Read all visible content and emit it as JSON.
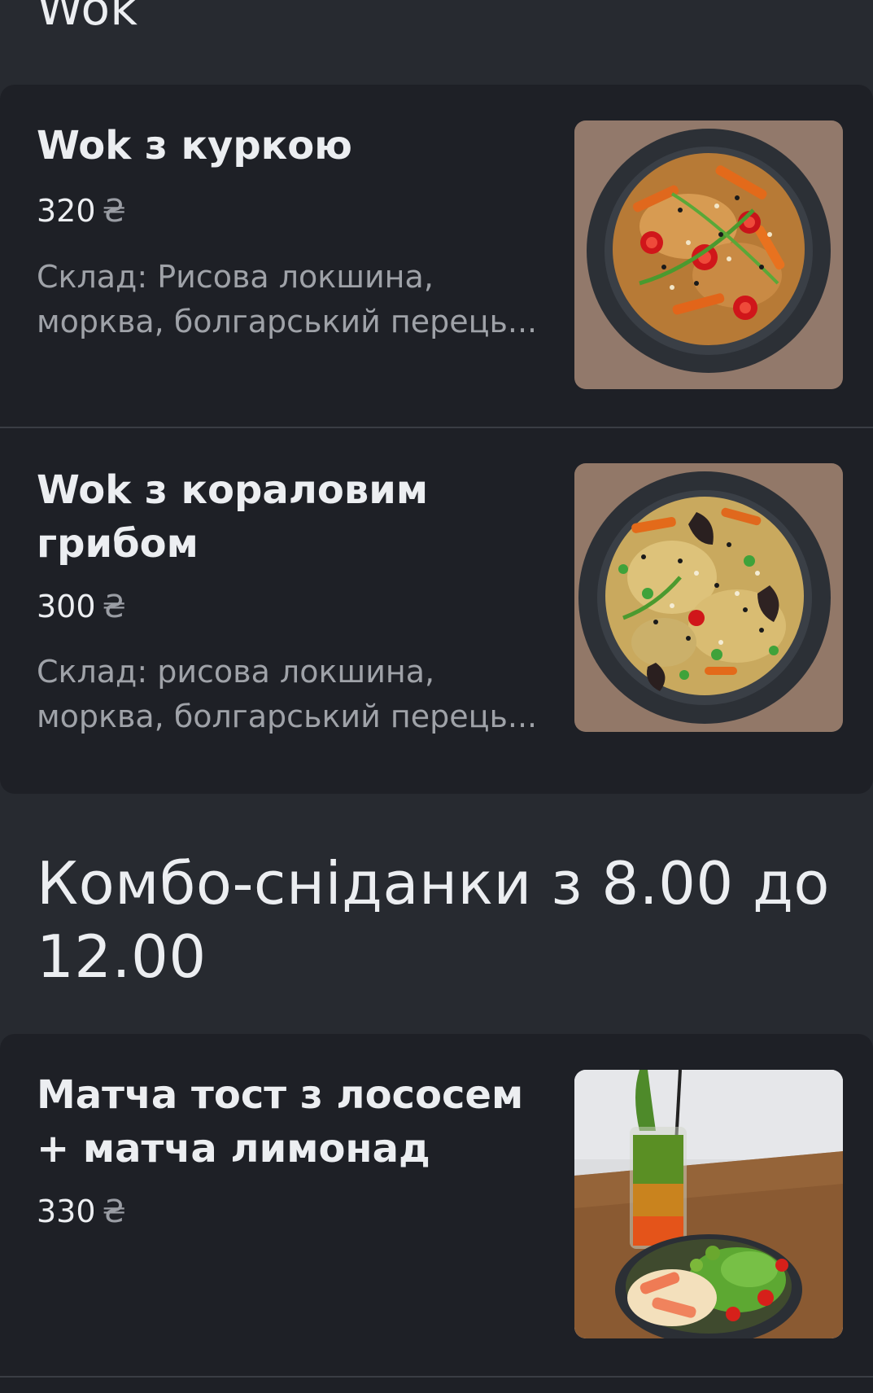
{
  "sections": {
    "wok": {
      "title": "Wok",
      "items": [
        {
          "name": "Wok з куркою",
          "price": "320",
          "currency": "₴",
          "description": "Склад: Рисова локшина, морква, болгарський перець..."
        },
        {
          "name": "Wok з кораловим грибом",
          "price": "300",
          "currency": "₴",
          "description": "Склад: рисова локшина, морква, болгарський перець..."
        }
      ]
    },
    "combo": {
      "title": "Комбо-сніданки з 8.00 до 12.00",
      "items": [
        {
          "name": "Матча тост з лососем + матча лимонад",
          "price": "330",
          "currency": "₴"
        }
      ]
    }
  },
  "colors": {
    "background": "#272a30",
    "card": "#1e2026",
    "text": "#eceef1",
    "muted_text": "#9fa2a8"
  }
}
